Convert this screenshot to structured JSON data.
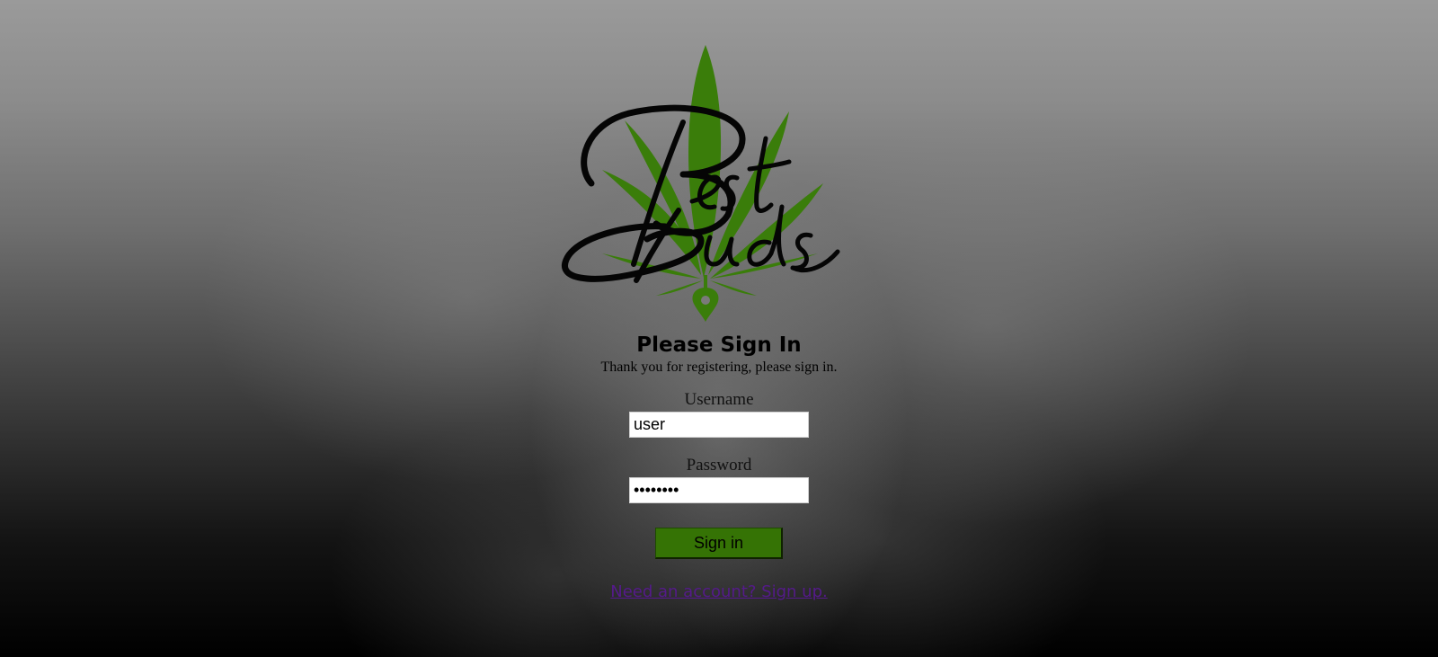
{
  "logo": {
    "wordmark": "Best Buds",
    "icon": "cannabis-leaf-icon",
    "leaf_color": "#3a7d0a"
  },
  "signin_form": {
    "title": "Please Sign In",
    "subtitle": "Thank you for registering, please sign in.",
    "username_label": "Username",
    "username_value": "user",
    "password_label": "Password",
    "password_value": "password",
    "submit_label": "Sign in",
    "submit_color": "#357305",
    "signup_link": "Need an account? Sign up.",
    "link_color": "#551a8b"
  }
}
